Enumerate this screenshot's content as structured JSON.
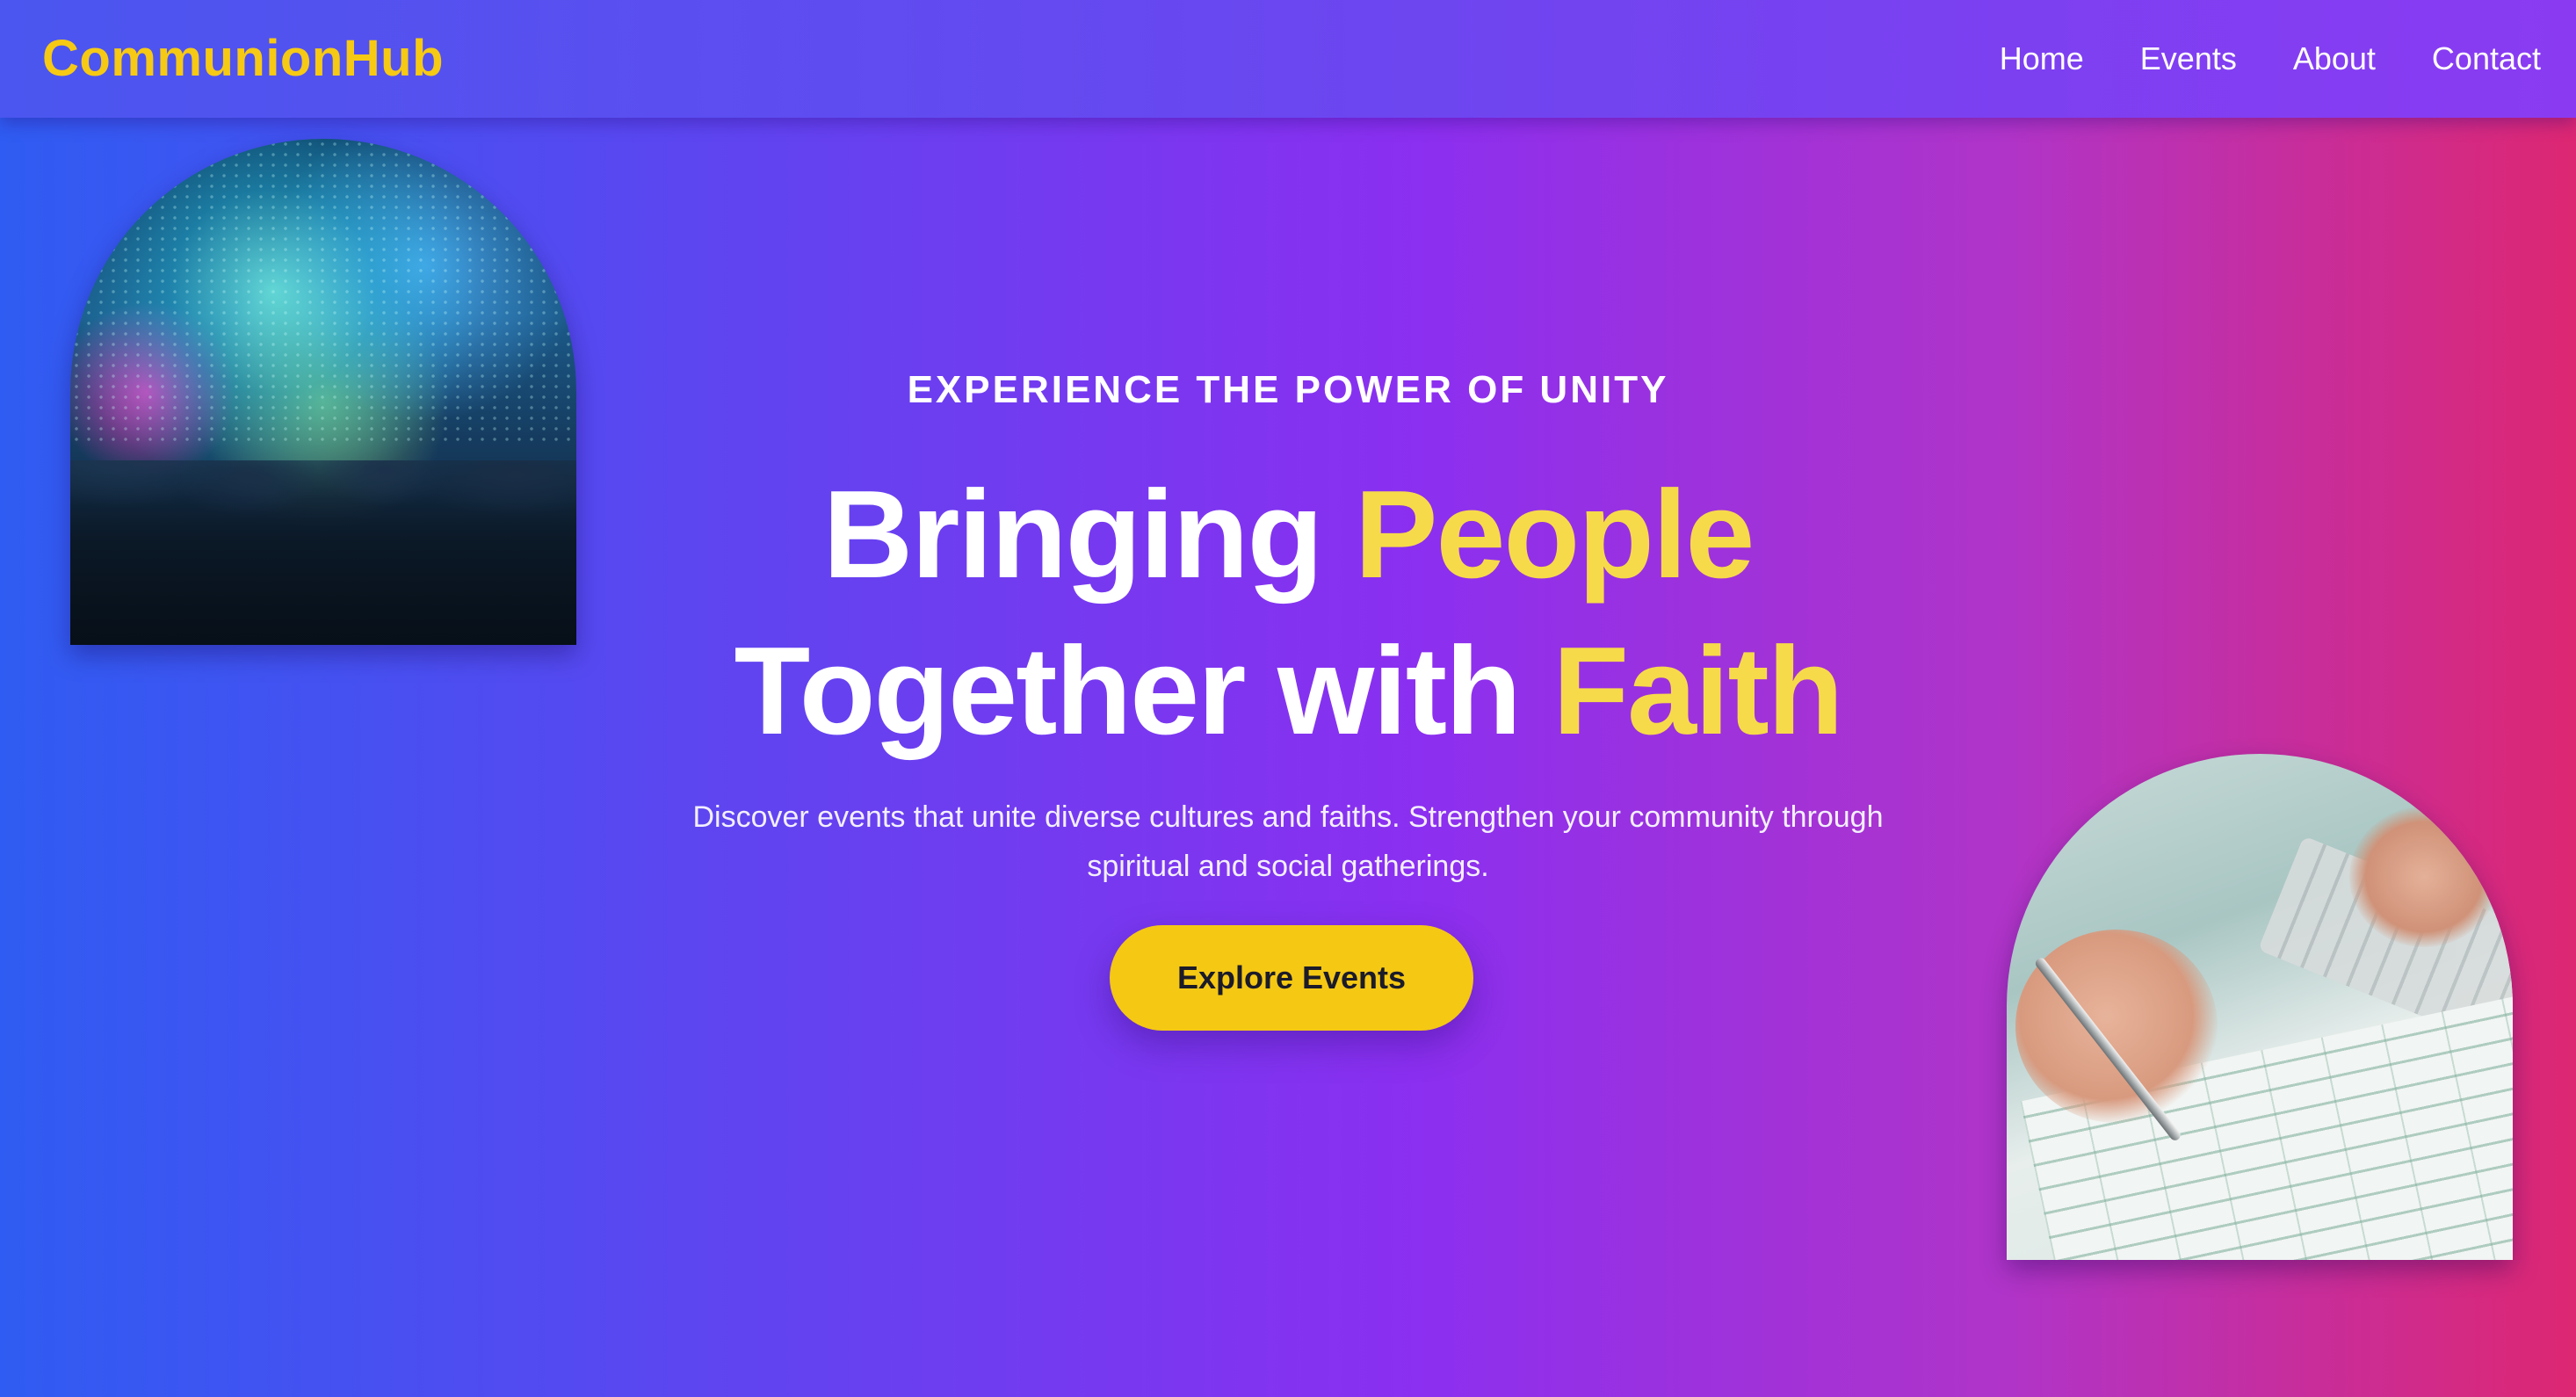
{
  "header": {
    "brand": "CommunionHub",
    "nav": [
      {
        "label": "Home"
      },
      {
        "label": "Events"
      },
      {
        "label": "About"
      },
      {
        "label": "Contact"
      }
    ]
  },
  "hero": {
    "eyebrow": "EXPERIENCE THE POWER OF UNITY",
    "headline": {
      "line1_part1": "Bringing ",
      "line1_accent": "People",
      "line2_part1": "Together with ",
      "line2_accent": "Faith"
    },
    "subtext_line1": "Discover events that unite diverse cultures and faiths. Strengthen your community through",
    "subtext_line2": "spiritual and social gatherings.",
    "cta_label": "Explore Events"
  },
  "images": {
    "left": "concert-crowd-image",
    "right": "writing-on-form-image"
  },
  "colors": {
    "brand": "#f6c915",
    "accent": "#f7da4a",
    "cta": "#f5c814",
    "gradient_start": "#2f5cf2",
    "gradient_mid": "#8b2ff0",
    "gradient_end": "#dd2772"
  }
}
